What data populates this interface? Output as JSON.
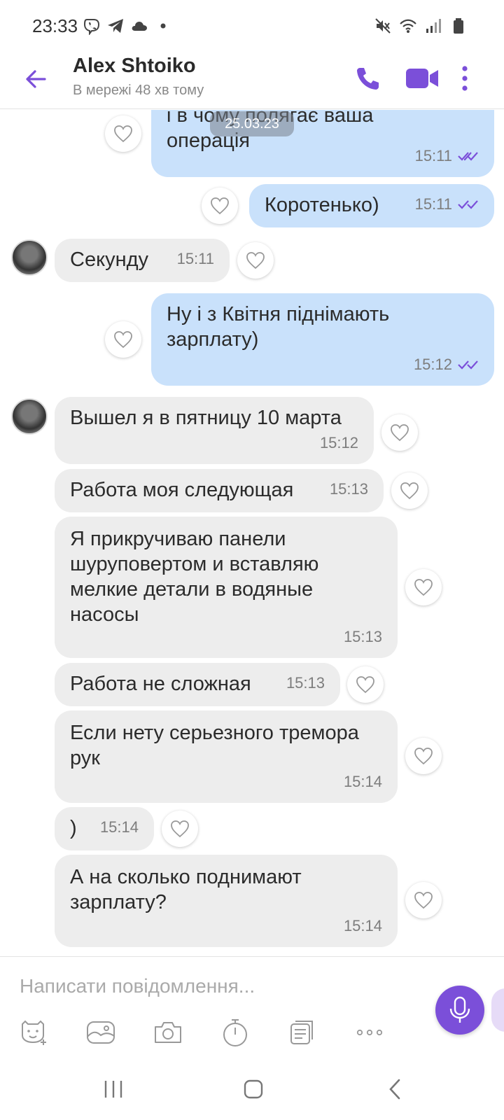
{
  "status_bar": {
    "time": "23:33",
    "left_icons": [
      "viber-icon",
      "telegram-icon",
      "cloud-icon",
      "dot-icon"
    ],
    "right_icons": [
      "mute-icon",
      "wifi-icon",
      "signal-icon",
      "battery-icon"
    ]
  },
  "header": {
    "contact_name": "Alex Shtoiko",
    "contact_status": "В мережі 48 хв тому",
    "accent_color": "#7b4fd9"
  },
  "chat": {
    "date_chip": "25.03.23",
    "messages": [
      {
        "dir": "out",
        "text": "і в чому полягає ваша\nоперація",
        "time": "15:11"
      },
      {
        "dir": "out",
        "text": "Коротенько)",
        "time": "15:11"
      },
      {
        "dir": "in",
        "text": "Секунду",
        "time": "15:11"
      },
      {
        "dir": "out",
        "text": "Ну і з Квітня піднімають\nзарплату)",
        "time": "15:12"
      },
      {
        "dir": "in",
        "text": "Вышел я в пятницу 10 марта",
        "time": "15:12"
      },
      {
        "dir": "in",
        "text": "Работа моя следующая",
        "time": "15:13"
      },
      {
        "dir": "in",
        "text": "Я прикручиваю панели\nшуруповертом и вставляю\nмелкие детали в водяные\nнасосы",
        "time": "15:13"
      },
      {
        "dir": "in",
        "text": "Работа не сложная",
        "time": "15:13"
      },
      {
        "dir": "in",
        "text": "Если нету серьезного тремора\nрук",
        "time": "15:14"
      },
      {
        "dir": "in",
        "text": ")",
        "time": "15:14"
      },
      {
        "dir": "in",
        "text": "А на сколько поднимают\nзарплату?",
        "time": "15:14"
      }
    ]
  },
  "composer": {
    "placeholder": "Написати повідомлення...",
    "tools": [
      "sticker-icon",
      "gallery-icon",
      "camera-icon",
      "timer-icon",
      "gif-icon",
      "more-icon"
    ]
  },
  "colors": {
    "outgoing_bubble": "#c9e1fb",
    "incoming_bubble": "#ededed",
    "accent": "#7b4fd9"
  }
}
